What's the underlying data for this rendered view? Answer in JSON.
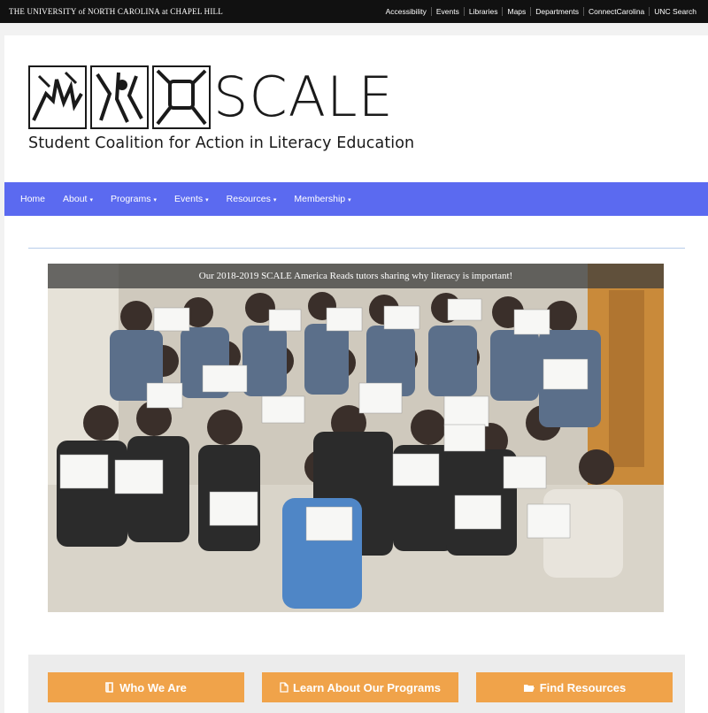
{
  "topbar": {
    "brand": "THE UNIVERSITY of NORTH CAROLINA at CHAPEL HILL",
    "links": [
      "Accessibility",
      "Events",
      "Libraries",
      "Maps",
      "Departments",
      "ConnectCarolina",
      "UNC Search"
    ]
  },
  "logo": {
    "wordmark": "SCALE",
    "subtitle": "Student Coalition for Action in Literacy Education"
  },
  "nav": {
    "items": [
      {
        "label": "Home",
        "dropdown": false
      },
      {
        "label": "About",
        "dropdown": true
      },
      {
        "label": "Programs",
        "dropdown": true
      },
      {
        "label": "Events",
        "dropdown": true
      },
      {
        "label": "Resources",
        "dropdown": true
      },
      {
        "label": "Membership",
        "dropdown": true
      }
    ],
    "caret": "▾"
  },
  "photo": {
    "caption": "Our 2018-2019 SCALE America Reads tutors sharing why literacy is important!"
  },
  "buttons": [
    {
      "label": "Who We Are",
      "icon": "book-icon"
    },
    {
      "label": "Learn About Our Programs",
      "icon": "document-icon"
    },
    {
      "label": "Find Resources",
      "icon": "folder-open-icon"
    }
  ],
  "colors": {
    "nav": "#5b6af0",
    "button": "#f0a34a",
    "topbar": "#111111"
  }
}
